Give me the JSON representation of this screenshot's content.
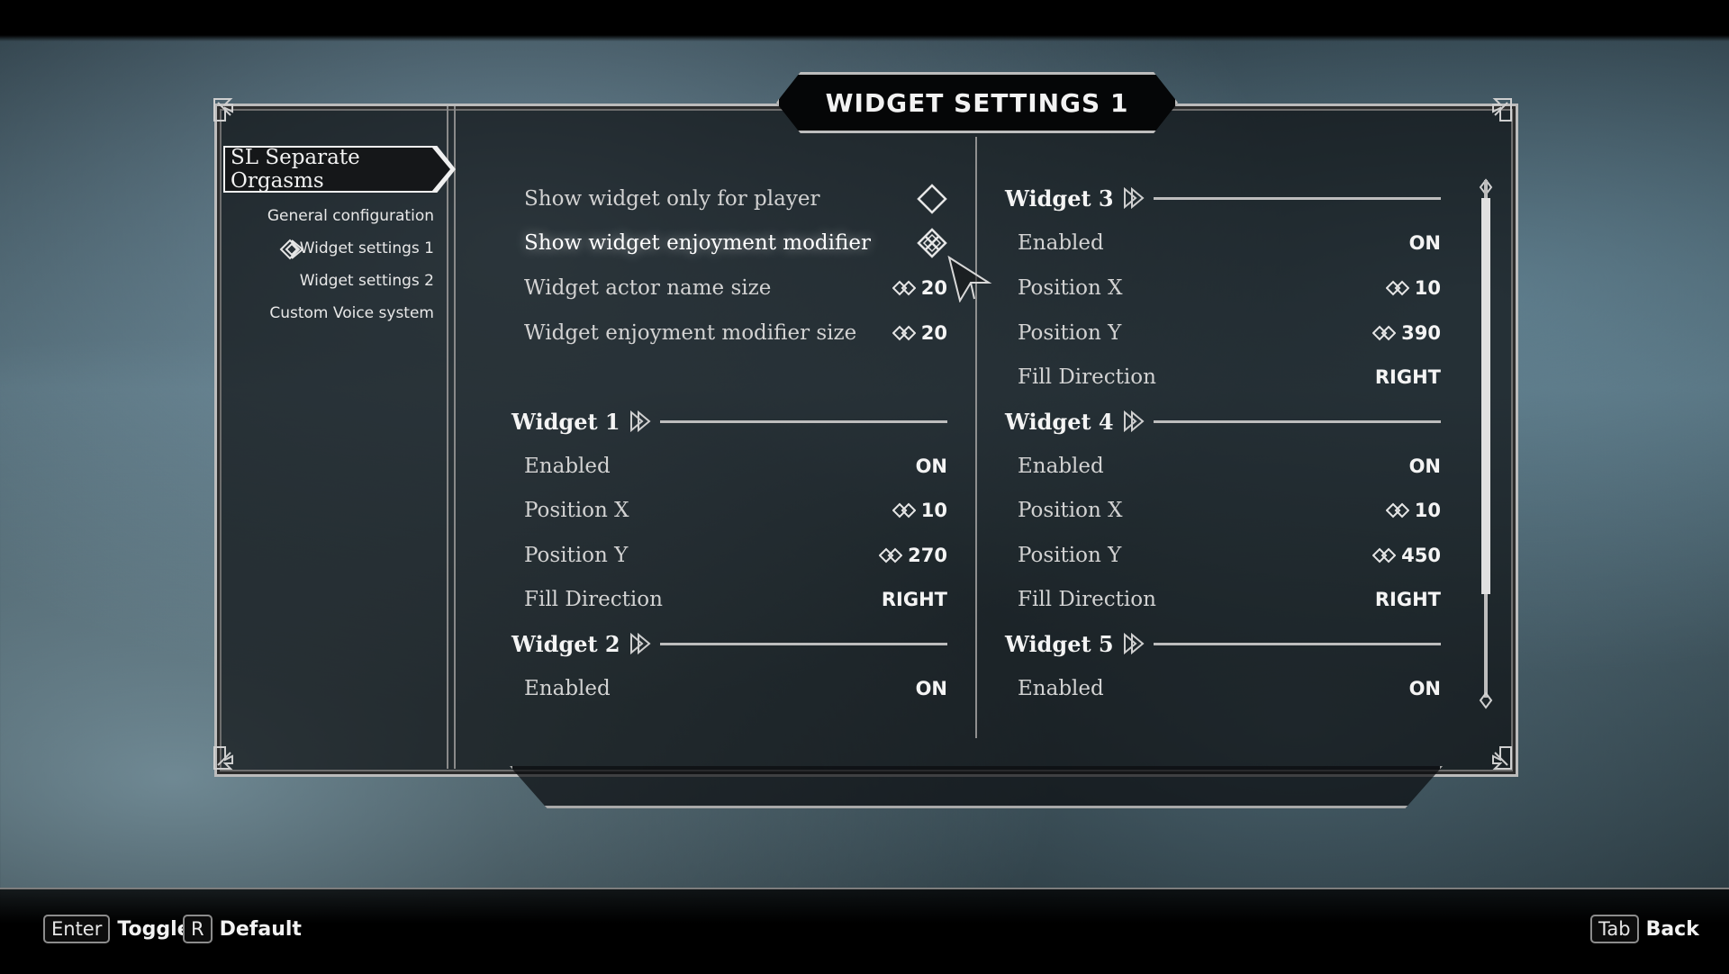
{
  "menu": {
    "title": "WIDGET SETTINGS 1",
    "mod_name": "SL Separate Orgasms",
    "pages": [
      {
        "label": "General configuration",
        "selected": false
      },
      {
        "label": "Widget settings 1",
        "selected": true
      },
      {
        "label": "Widget settings 2",
        "selected": false
      },
      {
        "label": "Custom Voice system",
        "selected": false
      }
    ]
  },
  "left": {
    "options": [
      {
        "label": "Show widget only for player",
        "type": "toggle",
        "checked": false
      },
      {
        "label": "Show widget enjoyment modifier",
        "type": "toggle",
        "checked": true
      },
      {
        "label": "Widget actor name size",
        "type": "slider",
        "value": "20"
      },
      {
        "label": "Widget enjoyment modifier size",
        "type": "slider",
        "value": "20"
      }
    ],
    "widget1": {
      "header": "Widget 1",
      "enabled_label": "Enabled",
      "enabled_value": "ON",
      "posx_label": "Position X",
      "posx_value": "10",
      "posy_label": "Position Y",
      "posy_value": "270",
      "fill_label": "Fill Direction",
      "fill_value": "RIGHT"
    },
    "widget2": {
      "header": "Widget 2",
      "enabled_label": "Enabled",
      "enabled_value": "ON"
    }
  },
  "right": {
    "widget3": {
      "header": "Widget 3",
      "enabled_label": "Enabled",
      "enabled_value": "ON",
      "posx_label": "Position X",
      "posx_value": "10",
      "posy_label": "Position Y",
      "posy_value": "390",
      "fill_label": "Fill Direction",
      "fill_value": "RIGHT"
    },
    "widget4": {
      "header": "Widget 4",
      "enabled_label": "Enabled",
      "enabled_value": "ON",
      "posx_label": "Position X",
      "posx_value": "10",
      "posy_label": "Position Y",
      "posy_value": "450",
      "fill_label": "Fill Direction",
      "fill_value": "RIGHT"
    },
    "widget5": {
      "header": "Widget 5",
      "enabled_label": "Enabled",
      "enabled_value": "ON"
    }
  },
  "footer": {
    "enter_key": "Enter",
    "enter_action": "Toggle",
    "r_key": "R",
    "r_action": "Default",
    "tab_key": "Tab",
    "tab_action": "Back"
  },
  "icons": {
    "slider": "double-diamond-slider-icon",
    "toggle_off": "empty-diamond-checkbox-icon",
    "toggle_on": "knot-diamond-checkbox-icon",
    "header": "arrow-knot-header-icon",
    "selected_page": "celtic-knot-icon",
    "corner": "celtic-corner-ornament-icon"
  }
}
